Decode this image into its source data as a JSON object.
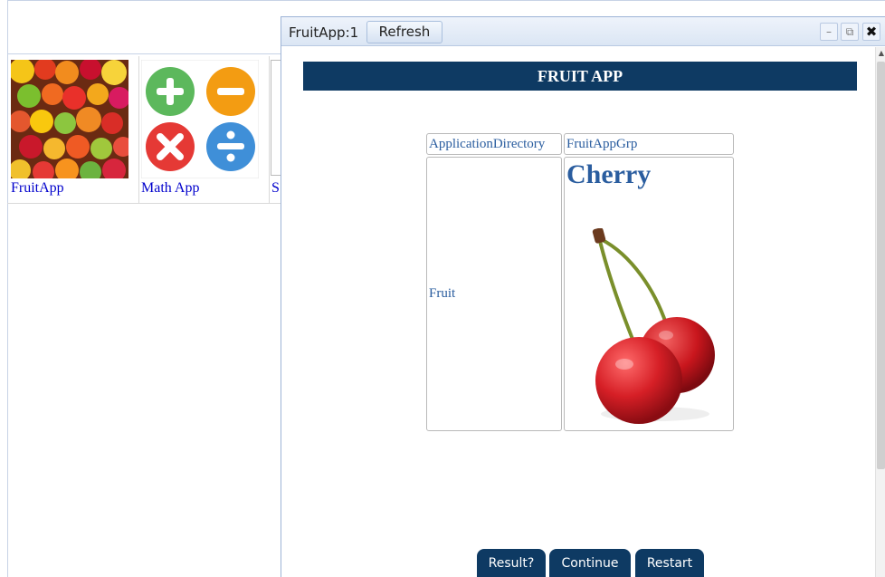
{
  "launcher": {
    "apps": [
      {
        "label": "FruitApp",
        "thumb_icon": "fruit-collage-icon"
      },
      {
        "label": "Math App",
        "thumb_icon": "math-operators-icon"
      },
      {
        "label": "S",
        "thumb_icon": "document-icon"
      }
    ]
  },
  "window": {
    "title": "FruitApp:1",
    "refresh_label": "Refresh",
    "controls": {
      "minimize": "–",
      "popout": "⧉",
      "close": "✖"
    }
  },
  "app": {
    "header": "FRUIT APP",
    "directory_label": "ApplicationDirectory",
    "directory_value": "FruitAppGrp",
    "fruit_label": "Fruit",
    "fruit_name": "Cherry",
    "fruit_icon": "cherry-icon"
  },
  "actions": {
    "result_label": "Result?",
    "continue_label": "Continue",
    "restart_label": "Restart"
  },
  "colors": {
    "header_bg": "#0e3a63",
    "link_text": "#2a5d9f",
    "cherry_red": "#d61f26"
  }
}
